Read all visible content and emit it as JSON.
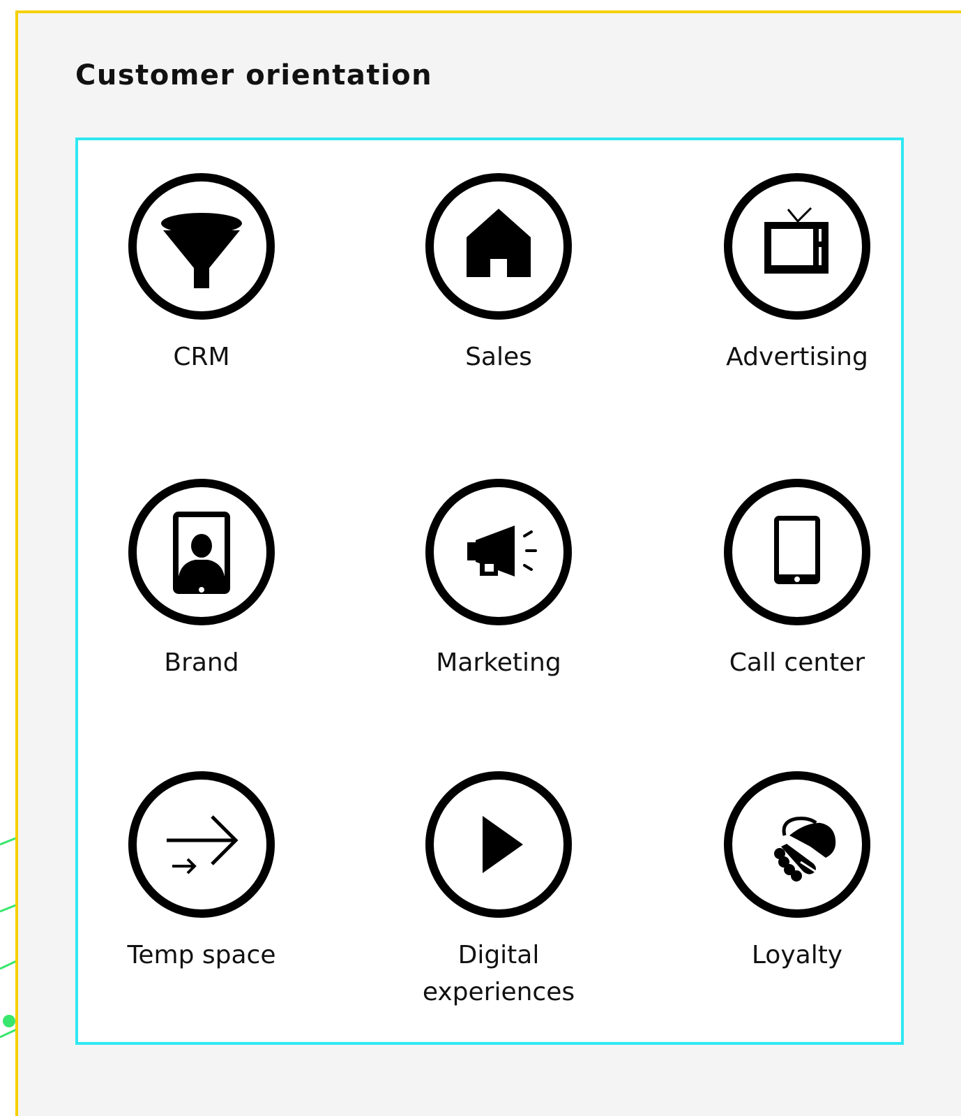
{
  "header": {
    "title": "Customer orientation"
  },
  "colors": {
    "panel_border": "#f5d000",
    "grid_border": "#2ee8f2",
    "panel_background": "#f4f4f4",
    "icon": "#000000",
    "decoration": "#39e66d"
  },
  "items": [
    {
      "label": "CRM",
      "icon": "funnel-icon"
    },
    {
      "label": "Sales",
      "icon": "house-icon"
    },
    {
      "label": "Advertising",
      "icon": "television-icon"
    },
    {
      "label": "Brand",
      "icon": "tablet-profile-icon"
    },
    {
      "label": "Marketing",
      "icon": "megaphone-icon"
    },
    {
      "label": "Call center",
      "icon": "tablet-icon"
    },
    {
      "label": "Temp space",
      "icon": "arrows-icon"
    },
    {
      "label": "Digital experiences",
      "icon": "play-icon"
    },
    {
      "label": "Loyalty",
      "icon": "handshake-icon"
    }
  ]
}
